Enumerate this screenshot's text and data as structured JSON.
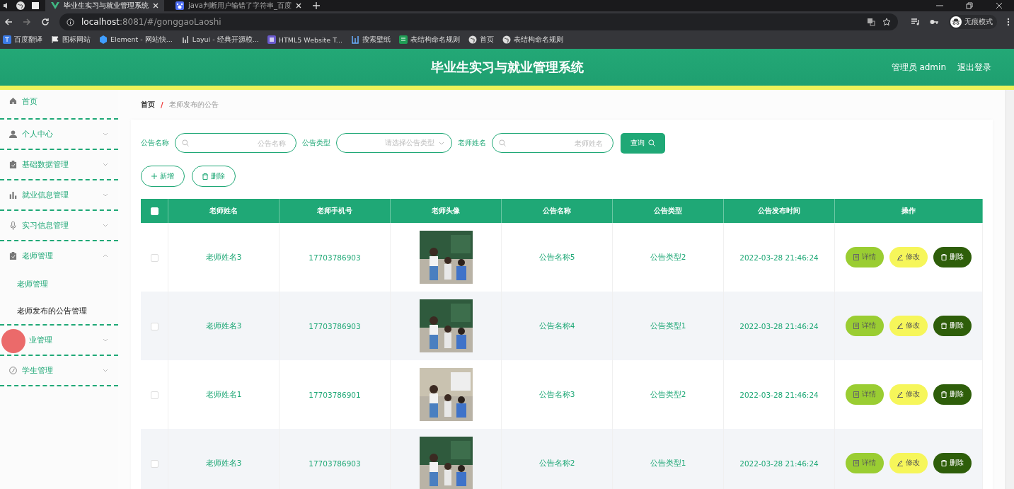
{
  "browser": {
    "tabs": [
      {
        "title": "毕业生实习与就业管理系统",
        "selected": true
      },
      {
        "title": "java判断用户输错了字符串_百度",
        "selected": false
      }
    ],
    "address": {
      "host": "localhost",
      "rest": ":8081/#/gonggaoLaoshi"
    },
    "bookmarks": [
      "百度翻译",
      "图标网站",
      "Element - 网站快...",
      "Layui - 经典开源模...",
      "HTML5 Website T...",
      "搜索壁纸",
      "表结构命名规则",
      "首页",
      "表结构命名规则"
    ],
    "profile": "无痕模式"
  },
  "header": {
    "title": "毕业生实习与就业管理系统",
    "user": "管理员 admin",
    "logout": "退出登录"
  },
  "sidebar": {
    "items": [
      {
        "label": "首页"
      },
      {
        "label": "个人中心",
        "expanded": false
      },
      {
        "label": "基础数据管理",
        "expanded": false
      },
      {
        "label": "就业信息管理",
        "expanded": false
      },
      {
        "label": "实习信息管理",
        "expanded": false
      },
      {
        "label": "老师管理",
        "expanded": true,
        "children": [
          {
            "label": "老师管理",
            "selected": false
          },
          {
            "label": "老师发布的公告管理",
            "selected": true
          }
        ]
      },
      {
        "label": "业管理",
        "expanded": false,
        "cursor": true
      },
      {
        "label": "学生管理",
        "expanded": false
      }
    ]
  },
  "breadcrumb": {
    "items": [
      "首页",
      "老师发布的公告"
    ],
    "separator": "/"
  },
  "filters": [
    {
      "label": "公告名称",
      "kind": "input",
      "placeholder": "公告名称"
    },
    {
      "label": "公告类型",
      "kind": "select",
      "placeholder": "请选择公告类型"
    },
    {
      "label": "老师姓名",
      "kind": "input",
      "placeholder": "老师姓名"
    }
  ],
  "query_button": "查询",
  "toolbar": [
    "新增",
    "删除"
  ],
  "table": {
    "select_all_checked": false,
    "columns": [
      "老师姓名",
      "老师手机号",
      "老师头像",
      "公告名称",
      "公告类型",
      "公告发布时间",
      "操作"
    ],
    "rows": [
      {
        "checked": false,
        "name": "老师姓名3",
        "phone": "17703786903",
        "photo": {
          "kind": "picture"
        },
        "title": "公告名称5",
        "type": "公告类型2",
        "time": "2022-03-28 21:46:24",
        "actions": [
          "详情",
          "修改",
          "删除"
        ]
      },
      {
        "checked": false,
        "name": "老师姓名3",
        "phone": "17703786903",
        "photo": {
          "kind": "picture"
        },
        "title": "公告名称4",
        "type": "公告类型1",
        "time": "2022-03-28 21:46:24",
        "actions": [
          "详情",
          "修改",
          "删除"
        ]
      },
      {
        "checked": false,
        "name": "老师姓名1",
        "phone": "17703786901",
        "photo": {
          "kind": "picture"
        },
        "title": "公告名称3",
        "type": "公告类型2",
        "time": "2022-03-28 21:46:24",
        "actions": [
          "详情",
          "修改",
          "删除"
        ]
      },
      {
        "checked": false,
        "name": "老师姓名3",
        "phone": "17703786903",
        "photo": {
          "kind": "picture"
        },
        "title": "公告名称2",
        "type": "公告类型1",
        "time": "2022-03-28 21:46:24",
        "actions": [
          "详情",
          "修改",
          "删除"
        ]
      }
    ]
  }
}
